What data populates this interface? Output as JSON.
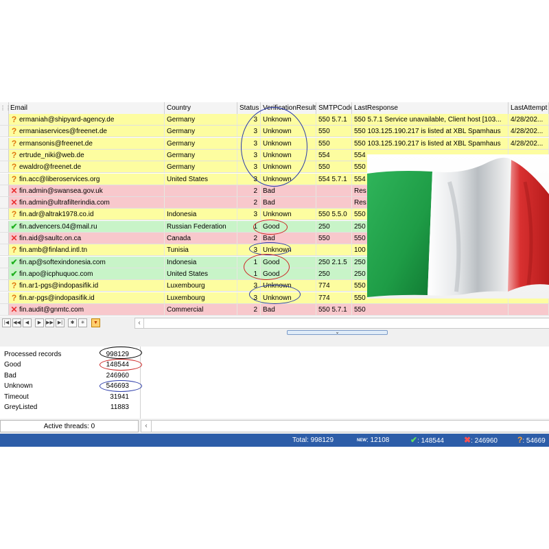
{
  "grid": {
    "columns": {
      "email": "Email",
      "country": "Country",
      "status": "Status",
      "verification": "VerificationResult",
      "smtp": "SMTPCode",
      "response": "LastResponse",
      "last": "LastAttempt"
    },
    "rows": [
      {
        "email": "ermaniah@shipyard-agency.de",
        "country": "Germany",
        "status": "3",
        "result": "Unknown",
        "smtp": "550 5.7.1",
        "response": "550 5.7.1 Service unavailable, Client host [103...",
        "last": "4/28/202...",
        "type": "unknown"
      },
      {
        "email": "ermaniaservices@freenet.de",
        "country": "Germany",
        "status": "3",
        "result": "Unknown",
        "smtp": "550",
        "response": "550 103.125.190.217 is listed at XBL Spamhaus",
        "last": "4/28/202...",
        "type": "unknown"
      },
      {
        "email": "ermansonis@freenet.de",
        "country": "Germany",
        "status": "3",
        "result": "Unknown",
        "smtp": "550",
        "response": "550 103.125.190.217 is listed at XBL Spamhaus",
        "last": "4/28/202...",
        "type": "unknown"
      },
      {
        "email": "ertrude_niki@web.de",
        "country": "Germany",
        "status": "3",
        "result": "Unknown",
        "smtp": "554",
        "response": "554",
        "last": "",
        "type": "unknown"
      },
      {
        "email": "ewaldro@freenet.de",
        "country": "Germany",
        "status": "3",
        "result": "Unknown",
        "smtp": "550",
        "response": "550",
        "last": "",
        "type": "unknown"
      },
      {
        "email": "fin.acc@liberoservices.org",
        "country": "United States",
        "status": "3",
        "result": "Unknown",
        "smtp": "554 5.7.1",
        "response": "554",
        "last": "",
        "type": "unknown"
      },
      {
        "email": "fin.admin@swansea.gov.uk",
        "country": "",
        "status": "2",
        "result": "Bad",
        "smtp": "",
        "response": "Res",
        "last": "",
        "type": "bad"
      },
      {
        "email": "fin.admin@ultrafilterindia.com",
        "country": "",
        "status": "2",
        "result": "Bad",
        "smtp": "",
        "response": "Res",
        "last": "",
        "type": "bad"
      },
      {
        "email": "fin.adr@altrak1978.co.id",
        "country": "Indonesia",
        "status": "3",
        "result": "Unknown",
        "smtp": "550 5.5.0",
        "response": "550",
        "last": "",
        "type": "unknown"
      },
      {
        "email": "fin.advencers.04@mail.ru",
        "country": "Russian Federation",
        "status": "1",
        "result": "Good",
        "smtp": "250",
        "response": "250",
        "last": "",
        "type": "good"
      },
      {
        "email": "fin.aid@saultc.on.ca",
        "country": "Canada",
        "status": "2",
        "result": "Bad",
        "smtp": "550",
        "response": "550",
        "last": "",
        "type": "bad"
      },
      {
        "email": "fin.amb@finland.intl.tn",
        "country": "Tunisia",
        "status": "3",
        "result": "Unknown",
        "smtp": "",
        "response": "100",
        "last": "",
        "type": "unknown"
      },
      {
        "email": "fin.ap@softexindonesia.com",
        "country": "Indonesia",
        "status": "1",
        "result": "Good",
        "smtp": "250 2.1.5",
        "response": "250",
        "last": "",
        "type": "good"
      },
      {
        "email": "fin.apo@icphuquoc.com",
        "country": "United States",
        "status": "1",
        "result": "Good",
        "smtp": "250",
        "response": "250",
        "last": "",
        "type": "good"
      },
      {
        "email": "fin.ar1-pgs@indopasifik.id",
        "country": "Luxembourg",
        "status": "3",
        "result": "Unknown",
        "smtp": "774",
        "response": "550",
        "last": "",
        "type": "unknown"
      },
      {
        "email": "fin.ar-pgs@indopasifik.id",
        "country": "Luxembourg",
        "status": "3",
        "result": "Unknown",
        "smtp": "774",
        "response": "550",
        "last": "",
        "type": "unknown"
      },
      {
        "email": "fin.audit@gnmtc.com",
        "country": "Commercial",
        "status": "2",
        "result": "Bad",
        "smtp": "550 5.7.1",
        "response": "550",
        "last": "",
        "type": "bad"
      }
    ]
  },
  "icons": {
    "unknown": "question-icon",
    "bad": "cross-icon",
    "good": "check-icon"
  },
  "stats": {
    "processed_label": "Processed records",
    "processed": "998129",
    "good_label": "Good",
    "good": "148544",
    "bad_label": "Bad",
    "bad": "246960",
    "unknown_label": "Unknown",
    "unknown": "546693",
    "timeout_label": "Timeout",
    "timeout": "31941",
    "greylisted_label": "GreyListed",
    "greylisted": "11883"
  },
  "threads": "Active threads: 0",
  "statusbar": {
    "total": "Total: 998129",
    "new_tag": "NEW",
    "new": ": 12108",
    "good": ": 148544",
    "bad": ": 246960",
    "unknown": ": 54669"
  },
  "colors": {
    "unknown_row": "#fdfda0",
    "bad_row": "#f8c8cc",
    "good_row": "#c8f4c8",
    "statusbar": "#2d5da8",
    "annotation_blue": "#2a3aa8",
    "annotation_red": "#cc2020",
    "flag_green": "#1e9c46",
    "flag_white": "#f4f4f4",
    "flag_red": "#d32a2a"
  }
}
